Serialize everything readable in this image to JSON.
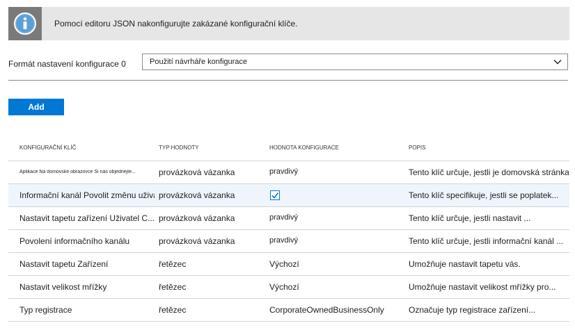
{
  "banner": {
    "text": "Pomocí editoru JSON nakonfigurujte zakázané konfigurační klíče."
  },
  "format": {
    "label": "Formát nastavení konfigurace 0",
    "selected": "Použití návrháře konfigurace"
  },
  "add_button": "Add",
  "table": {
    "headers": [
      "KONFIGURAČNÍ KLÍČ",
      "TYP HODNOTY",
      "HODNOTA KONFIGURACE",
      "POPIS"
    ],
    "rows": [
      {
        "key": "Aplikace Na domovské obrazovce Si nás objednejte...",
        "type": "provázková vázanka",
        "value": "pravdivý",
        "description": "Tento klíč určuje, jestli je domovská stránka"
      },
      {
        "key": "Informační kanál Povolit změnu uživatele...",
        "type": "provázková vázanka",
        "value": "",
        "checked": true,
        "description": "Tento klíč specifikuje, jestli se poplatek..."
      },
      {
        "key": "Nastavit tapetu zařízení Uživatel C...",
        "type": "provázková vázanka",
        "value": "pravdivý",
        "description": "Tento klíč určuje, jestli nastavit ..."
      },
      {
        "key": "Povolení informačního kanálu",
        "type": "provázková vázanka",
        "value": "pravdivý",
        "description": "Tento klíč určuje, jestli informační kanál ..."
      },
      {
        "key": "Nastavit tapetu Zařízení",
        "type": "řetězec",
        "value": "Výchozí",
        "description": "Umožňuje nastavit tapetu vás."
      },
      {
        "key": "Nastavit velikost mřížky",
        "type": "řetězec",
        "value": "Výchozí",
        "description": "Umožňuje nastavit velikost mřížky pro..."
      },
      {
        "key": "Typ registrace",
        "type": "řetězec",
        "value": "CorporateOwnedBusinessOnly",
        "description": "Označuje typ registrace zařízení..."
      }
    ]
  },
  "icons": {
    "banner": "info-icon",
    "select": "chevron-down-icon",
    "checkbox": "checkmark-icon"
  },
  "colors": {
    "accent": "#0078d4",
    "banner_bg": "#e6e6e6",
    "banner_icon_bg": "#7a7a7a",
    "selected_row_bg": "#eef5fc"
  }
}
